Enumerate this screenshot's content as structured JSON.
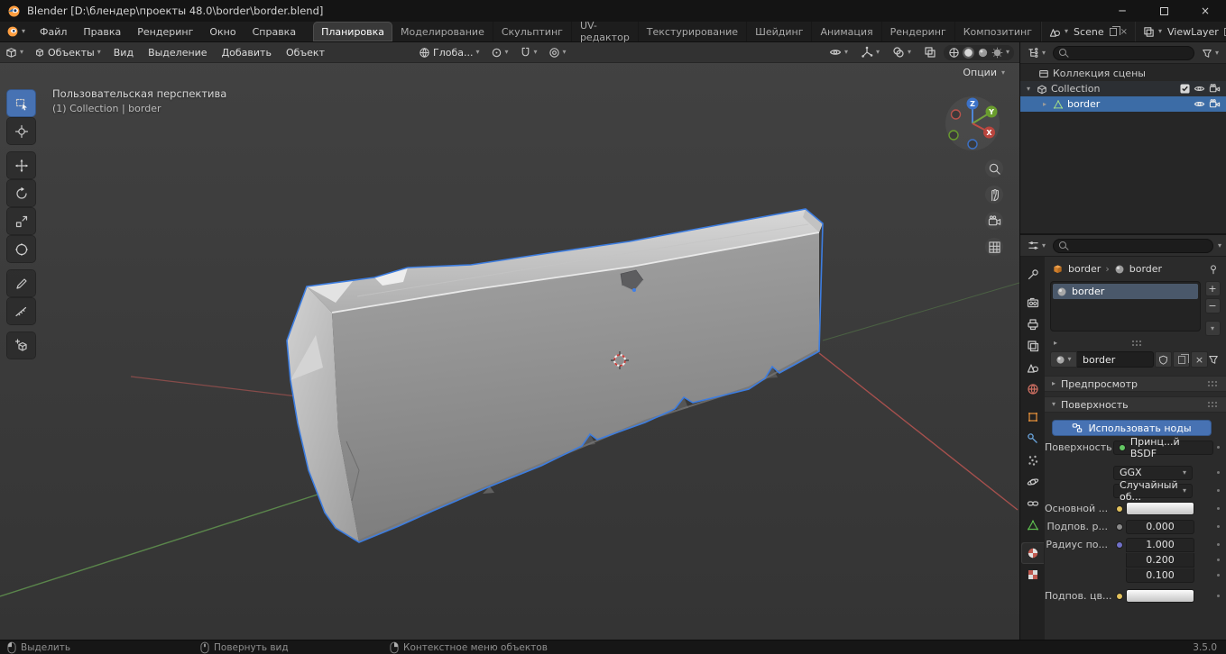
{
  "icons": {
    "caret_down": "▾",
    "caret_right": "▸",
    "close": "×",
    "minimize": "─",
    "plus": "+",
    "minus": "−",
    "crumb_sep": "›"
  },
  "titlebar": {
    "title": "Blender [D:\\блендер\\проекты 48.0\\border\\border.blend]"
  },
  "menubar": {
    "menus": [
      "Файл",
      "Правка",
      "Рендеринг",
      "Окно",
      "Справка"
    ],
    "workspaces": [
      "Планировка",
      "Моделирование",
      "Скульптинг",
      "UV-редактор",
      "Текстурирование",
      "Шейдинг",
      "Анимация",
      "Рендеринг",
      "Композитинг"
    ],
    "scene_name": "Scene",
    "viewlayer_name": "ViewLayer"
  },
  "viewport": {
    "header": {
      "mode": "Объекты",
      "menus": [
        "Вид",
        "Выделение",
        "Добавить",
        "Объект"
      ],
      "orientation": "Глоба...",
      "options_label": "Опции"
    },
    "overlay": {
      "line1": "Пользовательская перспектива",
      "line2": "(1) Collection | border"
    },
    "gizmo": {
      "x": "X",
      "y": "Y",
      "z": "Z"
    }
  },
  "outliner": {
    "rows": [
      {
        "label": "Коллекция сцены"
      },
      {
        "label": "Collection"
      },
      {
        "label": "border"
      }
    ]
  },
  "properties": {
    "breadcrumb": {
      "object": "border",
      "material": "border"
    },
    "slot_name": "border",
    "material_name": "border",
    "sections": {
      "preview": "Предпросмотр",
      "surface": "Поверхность"
    },
    "use_nodes_label": "Использовать ноды",
    "fields": {
      "surface_label": "Поверхность",
      "surface_value": "Принц...й BSDF",
      "distribution": "GGX",
      "subsurface_method": "Случайный об...",
      "base_color_label": "Основной ...",
      "subsurface_label": "Подпов. р...",
      "subsurface_value": "0.000",
      "radius_label": "Радиус по...",
      "radius_values": [
        "1.000",
        "0.200",
        "0.100"
      ],
      "subsurface_color_label": "Подпов. цв..."
    }
  },
  "statusbar": {
    "items": [
      "Выделить",
      "Повернуть вид",
      "Контекстное меню объектов"
    ],
    "version": "3.5.0"
  }
}
